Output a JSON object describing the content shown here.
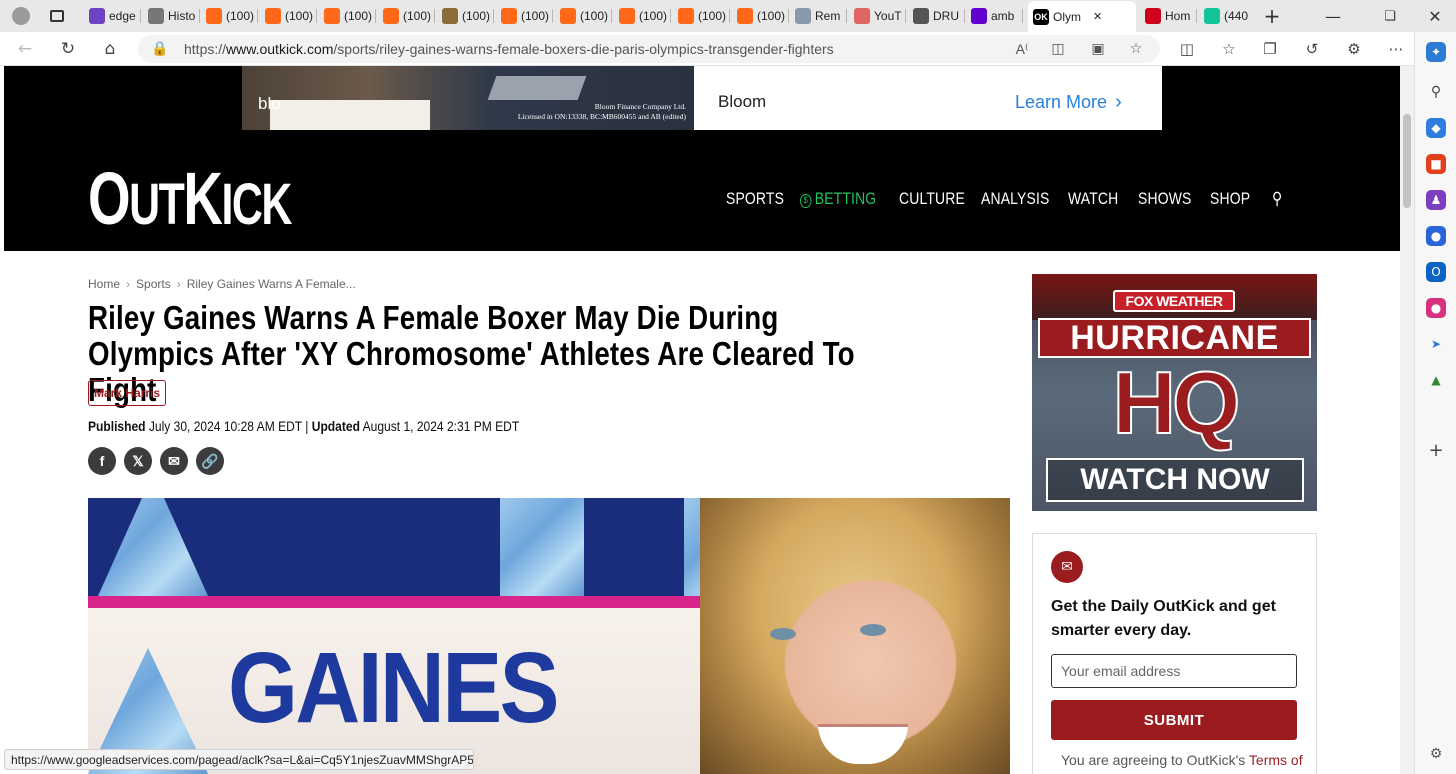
{
  "browser": {
    "tabs": [
      {
        "title": "edge",
        "icon": "yahoo-icon",
        "color": "#6f42c1"
      },
      {
        "title": "Histo",
        "icon": "history-icon",
        "color": "#777777"
      },
      {
        "title": "(100)",
        "icon": "substack-icon",
        "color": "#ff6719"
      },
      {
        "title": "(100)",
        "icon": "substack-icon",
        "color": "#ff6719"
      },
      {
        "title": "(100)",
        "icon": "substack-icon",
        "color": "#ff6719"
      },
      {
        "title": "(100)",
        "icon": "substack-icon",
        "color": "#ff6719"
      },
      {
        "title": "(100)",
        "icon": "avatar-icon",
        "color": "#8a6d3b"
      },
      {
        "title": "(100)",
        "icon": "substack-icon",
        "color": "#ff6719"
      },
      {
        "title": "(100)",
        "icon": "substack-icon",
        "color": "#ff6719"
      },
      {
        "title": "(100)",
        "icon": "substack-icon",
        "color": "#ff6719"
      },
      {
        "title": "(100)",
        "icon": "substack-icon",
        "color": "#ff6719"
      },
      {
        "title": "(100)",
        "icon": "substack-icon",
        "color": "#ff6719"
      },
      {
        "title": "Rem",
        "icon": "link-icon",
        "color": "#8899aa"
      },
      {
        "title": "YouT",
        "icon": "youtube-icon",
        "color": "#e06666"
      },
      {
        "title": "DRU",
        "icon": "drudge-icon",
        "color": "#555555"
      },
      {
        "title": "amb",
        "icon": "yahoo-icon",
        "color": "#6001d2"
      },
      {
        "title": "Olym",
        "icon": "outkick-icon",
        "color": "#000000",
        "active": true
      },
      {
        "title": "Hom",
        "icon": "news-icon",
        "color": "#d0021b"
      },
      {
        "title": "(440",
        "icon": "grammarly-icon",
        "color": "#15c39a"
      }
    ],
    "favicon_text_ok": "OK",
    "url_prefix": "https://",
    "url_host": "www.outkick.com",
    "url_path": "/sports/riley-gaines-warns-female-boxers-die-paris-olympics-transgender-fighters",
    "status_url": "https://www.googleadservices.com/pagead/aclk?sa=L&ai=Cq5Y1njesZuavMMShgrAP5Pn..."
  },
  "ad": {
    "brand": "Bloom",
    "cta": "Learn More",
    "logo_fragment": "blo",
    "fine_print_1": "Bloom Finance Company Ltd.",
    "fine_print_2": "Licensed in ON:13338, BC:MB600455 and AB (edited)"
  },
  "site": {
    "logo_big_1": "O",
    "logo_small_1": "UT",
    "logo_big_2": "K",
    "logo_small_2": "ICK",
    "nav": [
      "SPORTS",
      "BETTING",
      "CULTURE",
      "ANALYSIS",
      "WATCH",
      "SHOWS",
      "SHOP"
    ],
    "accent": "#22c55e",
    "brand_red": "#9b1c1f"
  },
  "article": {
    "breadcrumb": [
      "Home",
      "Sports",
      "Riley Gaines Warns A Female..."
    ],
    "headline": "Riley Gaines Warns A Female Boxer May Die During Olympics After 'XY Chromosome' Athletes Are Cleared To Fight",
    "author": "Mark Harris",
    "published_label": "Published",
    "published": "July 30, 2024 10:28 AM EDT",
    "separator": "|",
    "updated_label": "Updated",
    "updated": "August 1, 2024 2:31 PM EDT",
    "share": [
      "facebook",
      "x",
      "email",
      "link"
    ],
    "hero_text": "GAINES"
  },
  "promo": {
    "network": "FOX WEATHER",
    "title": "HURRICANE",
    "hq": "HQ",
    "cta": "WATCH NOW"
  },
  "newsletter": {
    "title": "Get the Daily OutKick and get smarter every day.",
    "placeholder": "Your email address",
    "submit": "SUBMIT",
    "terms_prefix": "You are agreeing to OutKick's",
    "terms_link": "Terms of"
  }
}
